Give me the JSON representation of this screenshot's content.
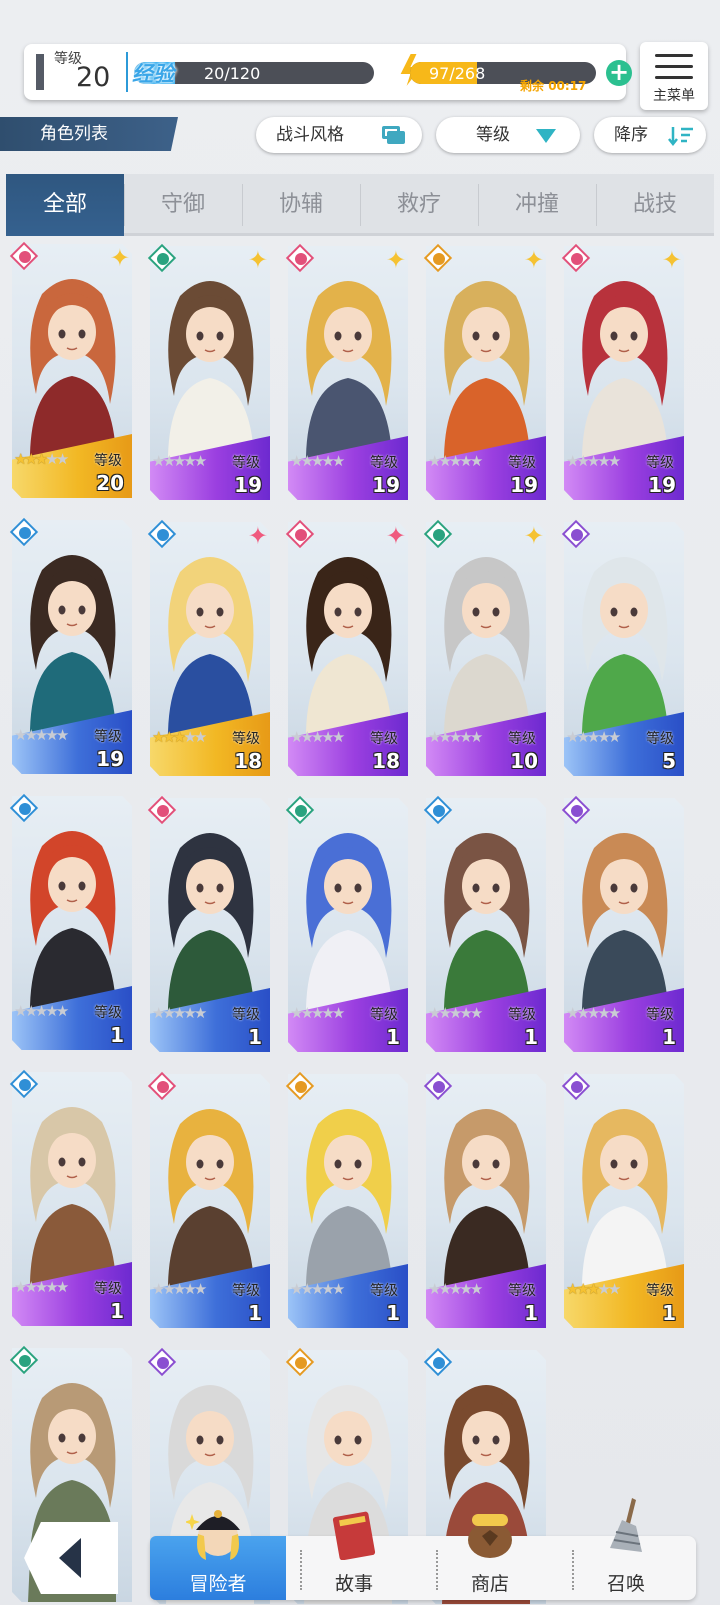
{
  "status": {
    "level_label": "等级",
    "level_value": "20",
    "exp_label": "经验",
    "exp_text": "20/120",
    "exp_fraction": 0.17,
    "energy_text": "97/268",
    "energy_fraction": 0.36,
    "remaining_label": "剩余",
    "remaining_time": "00:17"
  },
  "menu": {
    "label": "主菜单"
  },
  "page_title": "角色列表",
  "filters": {
    "battle_style": "战斗风格",
    "level": "等级",
    "sort": "降序"
  },
  "tabs": [
    "全部",
    "守御",
    "协辅",
    "救疗",
    "冲撞",
    "战技"
  ],
  "active_tab": 0,
  "level_label": "等级",
  "cards": [
    {
      "level": "20",
      "stars": 3,
      "class": "pink",
      "bg": "gold",
      "rarity": "gold"
    },
    {
      "level": "19",
      "stars": 0,
      "class": "green",
      "bg": "purple",
      "rarity": "gold"
    },
    {
      "level": "19",
      "stars": 0,
      "class": "pink",
      "bg": "purple",
      "rarity": "gold"
    },
    {
      "level": "19",
      "stars": 0,
      "class": "orange",
      "bg": "purple",
      "rarity": "gold"
    },
    {
      "level": "19",
      "stars": 0,
      "class": "pink",
      "bg": "purple",
      "rarity": "gold"
    },
    {
      "level": "19",
      "stars": 0,
      "class": "blue",
      "bg": "blue",
      "rarity": "none"
    },
    {
      "level": "18",
      "stars": 3,
      "class": "blue",
      "bg": "gold",
      "rarity": "pink"
    },
    {
      "level": "18",
      "stars": 0,
      "class": "pink",
      "bg": "purple",
      "rarity": "pink"
    },
    {
      "level": "10",
      "stars": 0,
      "class": "green",
      "bg": "purple",
      "rarity": "gold"
    },
    {
      "level": "5",
      "stars": 0,
      "class": "purple",
      "bg": "blue",
      "rarity": "none"
    },
    {
      "level": "1",
      "stars": 0,
      "class": "blue",
      "bg": "blue",
      "rarity": "none"
    },
    {
      "level": "1",
      "stars": 0,
      "class": "pink",
      "bg": "blue",
      "rarity": "none"
    },
    {
      "level": "1",
      "stars": 0,
      "class": "green",
      "bg": "purple",
      "rarity": "none"
    },
    {
      "level": "1",
      "stars": 0,
      "class": "blue",
      "bg": "purple",
      "rarity": "none"
    },
    {
      "level": "1",
      "stars": 0,
      "class": "purple",
      "bg": "purple",
      "rarity": "none"
    },
    {
      "level": "1",
      "stars": 0,
      "class": "blue",
      "bg": "purple",
      "rarity": "none"
    },
    {
      "level": "1",
      "stars": 0,
      "class": "pink",
      "bg": "blue",
      "rarity": "none"
    },
    {
      "level": "1",
      "stars": 0,
      "class": "orange",
      "bg": "blue",
      "rarity": "none"
    },
    {
      "level": "1",
      "stars": 0,
      "class": "purple",
      "bg": "purple",
      "rarity": "none"
    },
    {
      "level": "1",
      "stars": 3,
      "class": "purple",
      "bg": "gold",
      "rarity": "none"
    },
    {
      "level": "",
      "stars": 0,
      "class": "green",
      "bg": "blue",
      "rarity": "none"
    },
    {
      "level": "",
      "stars": 0,
      "class": "purple",
      "bg": "blue",
      "rarity": "none"
    },
    {
      "level": "",
      "stars": 0,
      "class": "orange",
      "bg": "blue",
      "rarity": "none"
    },
    {
      "level": "",
      "stars": 0,
      "class": "blue",
      "bg": "blue",
      "rarity": "none"
    }
  ],
  "colors": {
    "pink": "#e2507a",
    "green": "#2aa37f",
    "orange": "#e59a22",
    "blue": "#2f8fd6",
    "purple": "#8a4fd1",
    "bg_gold": "#f2b824",
    "bg_purple": "#9b3fe0",
    "bg_blue": "#3e6fd9",
    "accent": "#2f5780"
  },
  "nav": {
    "back": "back",
    "items": [
      {
        "label": "冒险者",
        "icon": "adventurer-icon"
      },
      {
        "label": "故事",
        "icon": "book-icon"
      },
      {
        "label": "商店",
        "icon": "shop-bag-icon"
      },
      {
        "label": "召唤",
        "icon": "summon-broom-icon"
      }
    ]
  }
}
